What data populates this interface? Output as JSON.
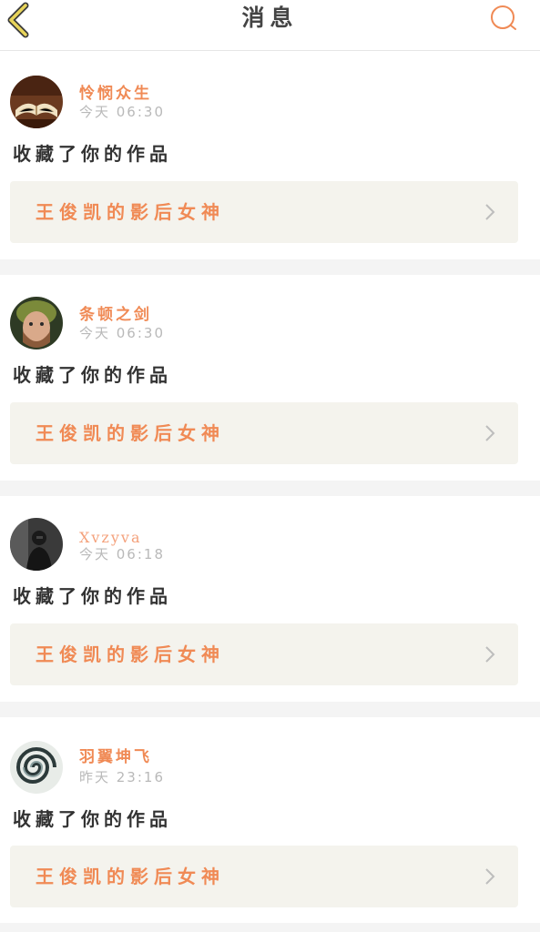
{
  "header": {
    "title": "消息",
    "back_icon": "chevron-left-icon",
    "search_icon": "search-icon"
  },
  "colors": {
    "accent": "#f08a55",
    "title_text": "#444444",
    "back_icon_stroke": "#c9b24a",
    "card_background": "#f4f3ed",
    "divider": "#f4f4f4",
    "timestamp_text": "#b9b9b9"
  },
  "messages": [
    {
      "username": "怜悯众生",
      "timestamp": "今天 06:30",
      "action": "收藏了你的作品",
      "work_title": "王俊凯的影后女神",
      "avatar": "open-book-avatar"
    },
    {
      "username": "条顿之剑",
      "timestamp": "今天 06:30",
      "action": "收藏了你的作品",
      "work_title": "王俊凯的影后女神",
      "avatar": "helmet-man-avatar"
    },
    {
      "username": "Xvzyva",
      "timestamp": "今天 06:18",
      "action": "收藏了你的作品",
      "work_title": "王俊凯的影后女神",
      "avatar": "dark-figure-avatar"
    },
    {
      "username": "羽翼坤飞",
      "timestamp": "昨天 23:16",
      "action": "收藏了你的作品",
      "work_title": "王俊凯的影后女神",
      "avatar": "swirl-avatar"
    }
  ]
}
